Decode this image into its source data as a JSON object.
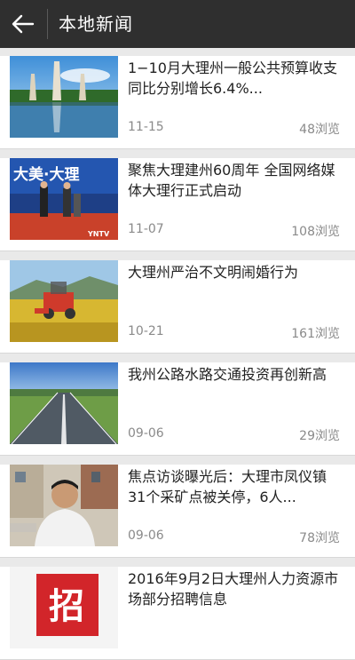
{
  "header": {
    "back_icon": "back-arrow-icon",
    "title": "本地新闻"
  },
  "news": [
    {
      "title": "1−10月大理州一般公共预算收支同比分别增长6.4%...",
      "date": "11-15",
      "views": "48浏览",
      "thumb": "pagoda-lake-photo"
    },
    {
      "title": "聚焦大理建州60周年 全国网络媒体大理行正式启动",
      "date": "11-07",
      "views": "108浏览",
      "thumb": "event-stage-photo",
      "thumb_text": [
        "大美·大理",
        "YNTV"
      ]
    },
    {
      "title": "大理州严治不文明闹婚行为",
      "date": "10-21",
      "views": "161浏览",
      "thumb": "rice-harvester-photo"
    },
    {
      "title": "我州公路水路交通投资再创新高",
      "date": "09-06",
      "views": "29浏览",
      "thumb": "highway-photo"
    },
    {
      "title": "焦点访谈曝光后：大理市凤仪镇31个采矿点被关停，6人...",
      "date": "09-06",
      "views": "78浏览",
      "thumb": "interview-man-photo"
    },
    {
      "title": "2016年9月2日大理州人力资源市场部分招聘信息",
      "date": "",
      "views": "",
      "thumb": "recruitment-poster",
      "thumb_text": [
        "招"
      ]
    }
  ]
}
